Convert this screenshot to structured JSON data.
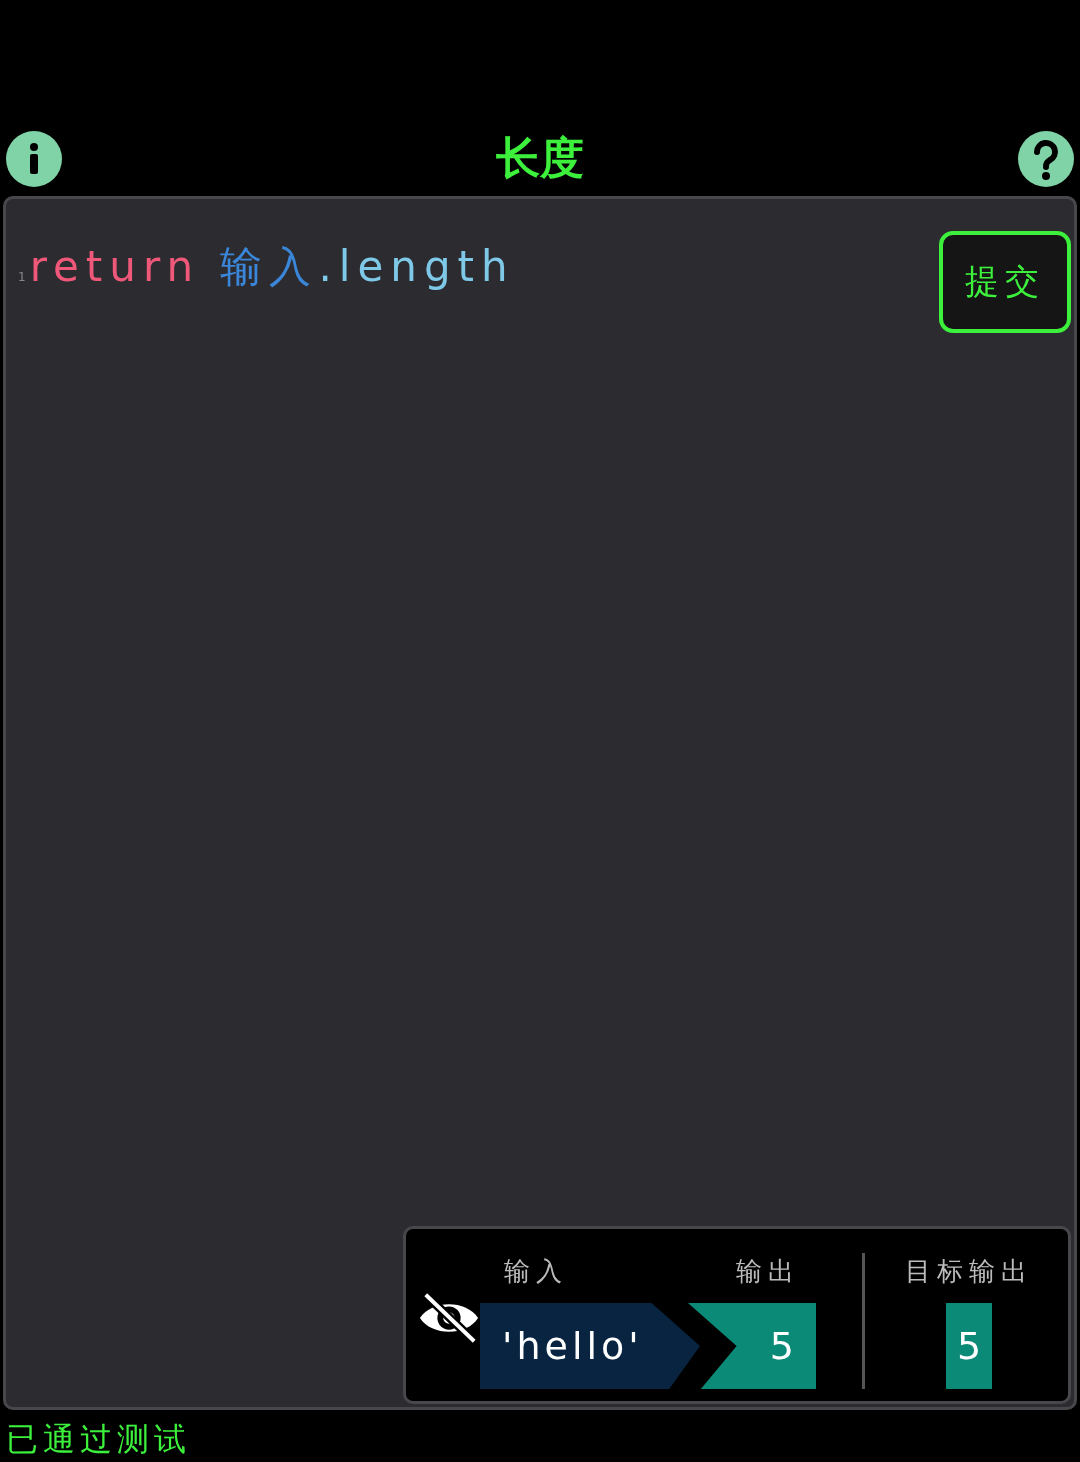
{
  "header": {
    "title": "长度"
  },
  "editor": {
    "line_number": "1",
    "tokens": [
      {
        "text": "return ",
        "kind": "keyword"
      },
      {
        "text": "输入",
        "kind": "variable"
      },
      {
        "text": ".length",
        "kind": "property"
      }
    ]
  },
  "submit_button": {
    "label": "提交"
  },
  "test_panel": {
    "input_label": "输入",
    "output_label": "输出",
    "target_label": "目标输出",
    "input_value": "'hello'",
    "output_value": "5",
    "target_value": "5"
  },
  "status": "已通过测试"
}
